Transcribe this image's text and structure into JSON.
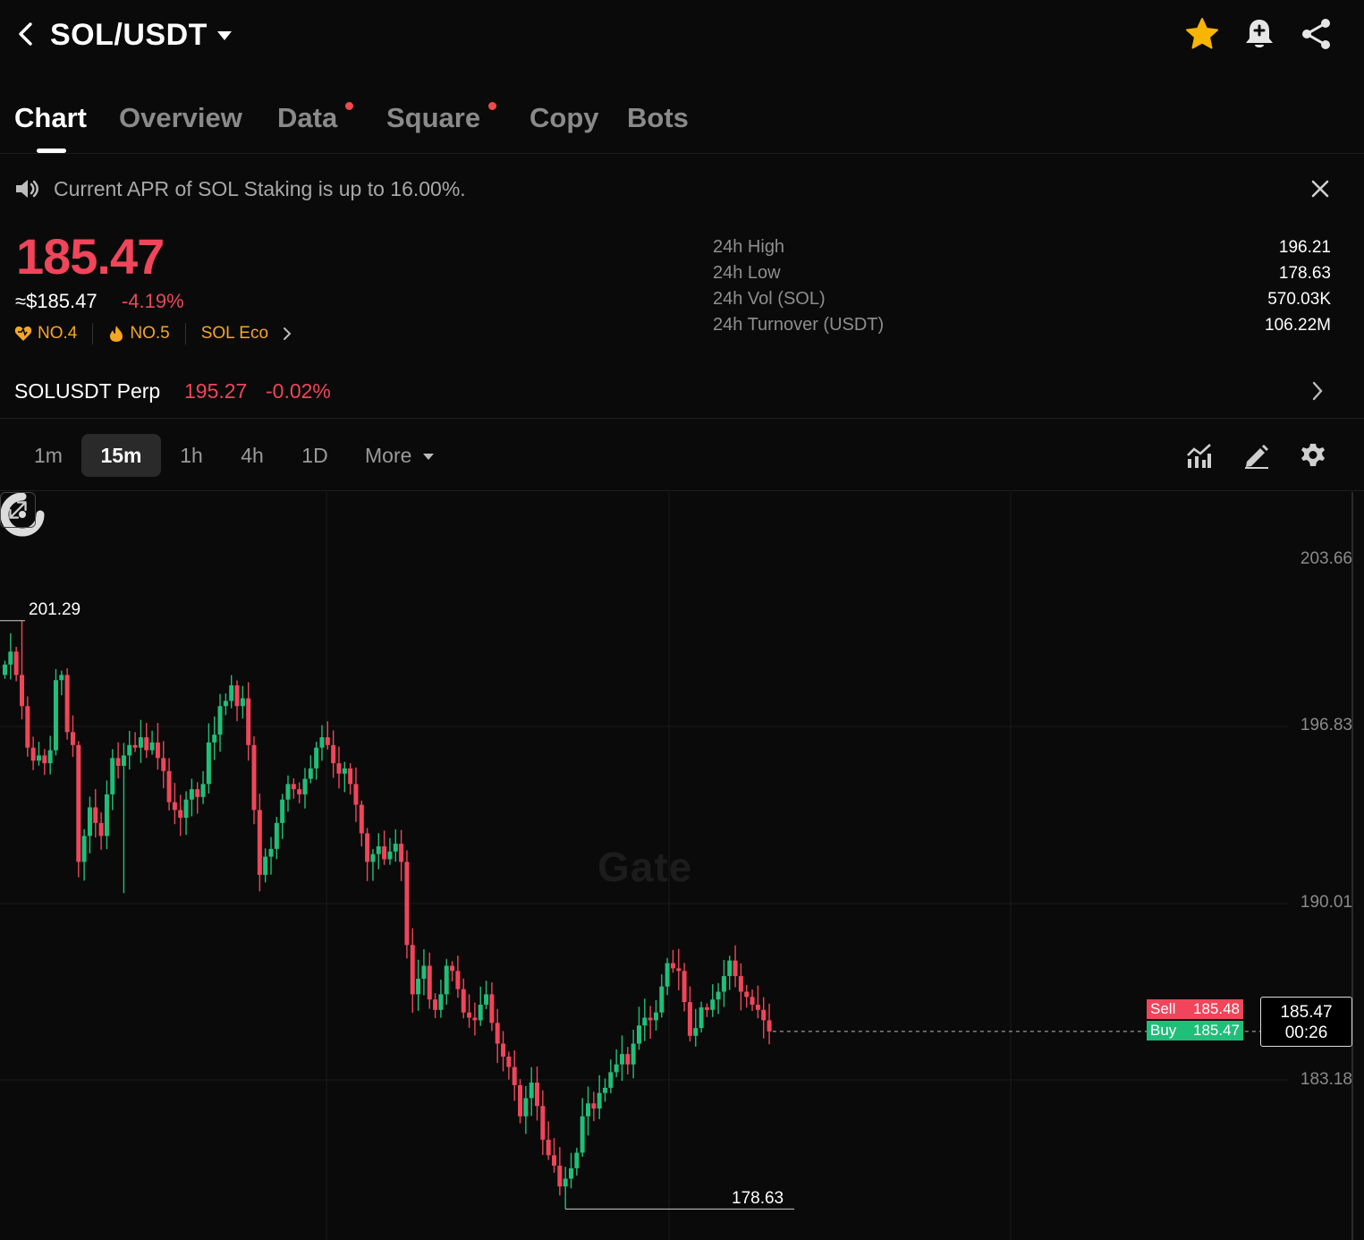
{
  "header": {
    "pair": "SOL/USDT"
  },
  "tabs": [
    {
      "label": "Chart"
    },
    {
      "label": "Overview"
    },
    {
      "label": "Data"
    },
    {
      "label": "Square"
    },
    {
      "label": "Copy"
    },
    {
      "label": "Bots"
    }
  ],
  "announcement": {
    "text": "Current APR of SOL Staking is up to 16.00%."
  },
  "ticker": {
    "last_price": "185.47",
    "usd_value": "≈$185.47",
    "change": "-4.19%",
    "tags": [
      "NO.4",
      "NO.5",
      "SOL Eco"
    ]
  },
  "stats": [
    {
      "label": "24h High",
      "value": "196.21"
    },
    {
      "label": "24h Low",
      "value": "178.63"
    },
    {
      "label": "24h Vol (SOL)",
      "value": "570.03K"
    },
    {
      "label": "24h Turnover (USDT)",
      "value": "106.22M"
    }
  ],
  "perp": {
    "name": "SOLUSDT Perp",
    "price": "195.27",
    "change": "-0.02%"
  },
  "intervals": [
    "1m",
    "15m",
    "1h",
    "4h",
    "1D",
    "More"
  ],
  "active_interval": "15m",
  "chart": {
    "y_labels": [
      "203.66",
      "196.83",
      "190.01",
      "183.18"
    ],
    "max_label": "201.29",
    "min_label": "178.63",
    "watermark": "Gate",
    "sell_label": "Sell",
    "sell_price": "185.48",
    "buy_label": "Buy",
    "buy_price": "185.47",
    "last_price": "185.47",
    "countdown": "00:26"
  },
  "colors": {
    "up": "#1fbf7a",
    "down": "#f0455a",
    "accent": "#f5a623",
    "bg": "#0a0a0a"
  },
  "chart_data": {
    "type": "candlestick",
    "interval": "15m",
    "symbol": "SOL/USDT",
    "ylim": [
      176.5,
      205.0
    ],
    "high_marker": 201.29,
    "low_marker": 178.63,
    "close_series": [
      199.6,
      200.1,
      199.2,
      198.0,
      196.4,
      195.9,
      196.1,
      195.8,
      196.3,
      199.0,
      199.2,
      197.0,
      196.5,
      192.0,
      193.0,
      194.1,
      193.5,
      193.0,
      194.6,
      196.0,
      195.7,
      196.1,
      196.5,
      196.4,
      196.8,
      196.3,
      196.6,
      196.0,
      195.5,
      194.3,
      194.0,
      193.7,
      194.4,
      194.8,
      194.5,
      195.0,
      196.6,
      196.9,
      198.0,
      198.2,
      198.8,
      198.0,
      198.3,
      196.5,
      194.0,
      191.5,
      192.2,
      192.5,
      193.5,
      194.4,
      195.0,
      194.8,
      194.6,
      195.2,
      195.6,
      196.4,
      196.8,
      196.5,
      195.8,
      195.4,
      195.6,
      195.0,
      194.2,
      193.1,
      192.0,
      192.3,
      192.6,
      192.1,
      192.4,
      192.7,
      192.0,
      188.8,
      186.9,
      187.5,
      188.0,
      186.7,
      186.3,
      186.9,
      188.0,
      187.8,
      187.1,
      186.2,
      186.0,
      185.9,
      186.5,
      186.9,
      185.8,
      185.0,
      184.5,
      184.1,
      183.4,
      182.2,
      182.9,
      183.5,
      182.6,
      181.3,
      180.7,
      180.3,
      179.5,
      179.8,
      180.2,
      180.8,
      182.2,
      182.7,
      182.5,
      183.1,
      183.3,
      183.9,
      184.2,
      184.6,
      184.2,
      185.0,
      185.7,
      186.0,
      185.9,
      186.2,
      187.2,
      188.1,
      187.9,
      187.8,
      186.6,
      185.3,
      185.6,
      186.4,
      186.3,
      186.7,
      187.0,
      187.6,
      188.2,
      187.6,
      187.0,
      186.8,
      186.5,
      186.3,
      185.9,
      185.47
    ]
  }
}
